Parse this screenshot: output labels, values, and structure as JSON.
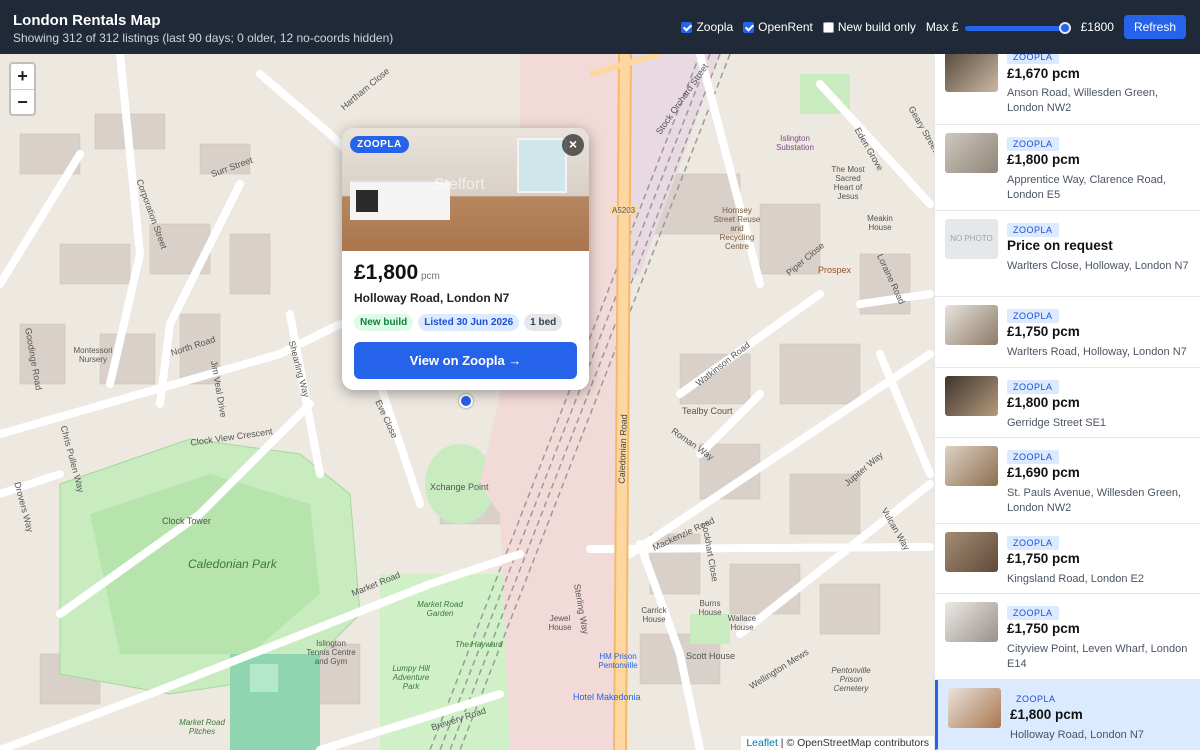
{
  "header": {
    "title": "London Rentals Map",
    "subtitle": "Showing 312 of 312 listings (last 90 days; 0 older, 12 no-coords hidden)",
    "filters": [
      {
        "label": "Zoopla",
        "checked": true
      },
      {
        "label": "OpenRent",
        "checked": true
      },
      {
        "label": "New build only",
        "checked": false
      }
    ],
    "max_label": "Max £",
    "max_value": "£1800",
    "refresh_label": "Refresh"
  },
  "map": {
    "zoom_in": "+",
    "zoom_out": "−",
    "attribution_leaflet": "Leaflet",
    "attribution_osm": "| © OpenStreetMap contributors",
    "labels": [
      "North Road",
      "Surr Street",
      "Corporation Street",
      "Jim Veal Drive",
      "Clock View Crescent",
      "Market Road",
      "Caledonian Park",
      "Clock Tower",
      "Caledonian Road",
      "Mackenzie Road",
      "Piper Close",
      "Roman Way",
      "Watkinson Road",
      "Hornsey Street Reuse and Recycling Centre",
      "Lockhart Close",
      "Brewery Road",
      "HM Prison Pentonville",
      "Hotel Makedonia",
      "Xchange Point",
      "Wellington Mews",
      "Jupiter Way",
      "A5203",
      "Islington Tennis Centre and Gym",
      "Market Road Pitches",
      "Montessori Nursery",
      "The Most Sacred Heart of Jesus",
      "Prospex",
      "Tealby Court",
      "Sterling Way",
      "Shearling Way",
      "Eve Close",
      "Hartham Close",
      "Stock Orchard Street",
      "Market Road Garden",
      "Jewel House",
      "Burns House",
      "Wallace House",
      "Scott House",
      "Carrick House",
      "Lumpy Hill Adventure Park",
      "The Hayward",
      "Pentonville Prison Cemetery",
      "Drovers Way",
      "Chris Pullen Way",
      "Goodinge Road",
      "Meakin House",
      "Loraine Road",
      "Eden Grove",
      "Geary Street",
      "Vulcan Way",
      "Islington Substation"
    ]
  },
  "popup": {
    "source": "ZOOPLA",
    "watermark": "Stelfort",
    "close": "×",
    "price": "£1,800",
    "price_unit": "pcm",
    "address": "Holloway Road, London N7",
    "chips": [
      "New build",
      "Listed 30 Jun 2026",
      "1 bed"
    ],
    "cta": "View on Zoopla →"
  },
  "listings": [
    {
      "source": "ZOOPLA",
      "price": "£1,670 pcm",
      "address": "Anson Road, Willesden Green, London NW2",
      "photo": true
    },
    {
      "source": "ZOOPLA",
      "price": "£1,800 pcm",
      "address": "Apprentice Way, Clarence Road, London E5",
      "photo": true
    },
    {
      "source": "ZOOPLA",
      "price": "Price on request",
      "address": "Warlters Close, Holloway, London N7",
      "photo": false,
      "placeholder": "NO PHOTO"
    },
    {
      "source": "ZOOPLA",
      "price": "£1,750 pcm",
      "address": "Warlters Road, Holloway, London N7",
      "photo": true
    },
    {
      "source": "ZOOPLA",
      "price": "£1,800 pcm",
      "address": "Gerridge Street SE1",
      "photo": true
    },
    {
      "source": "ZOOPLA",
      "price": "£1,690 pcm",
      "address": "St. Pauls Avenue, Willesden Green, London NW2",
      "photo": true
    },
    {
      "source": "ZOOPLA",
      "price": "£1,750 pcm",
      "address": "Kingsland Road, London E2",
      "photo": true
    },
    {
      "source": "ZOOPLA",
      "price": "£1,750 pcm",
      "address": "Cityview Point, Leven Wharf, London E14",
      "photo": true
    },
    {
      "source": "ZOOPLA",
      "price": "£1,800 pcm",
      "address": "Holloway Road, London N7",
      "photo": true,
      "active": true
    }
  ]
}
